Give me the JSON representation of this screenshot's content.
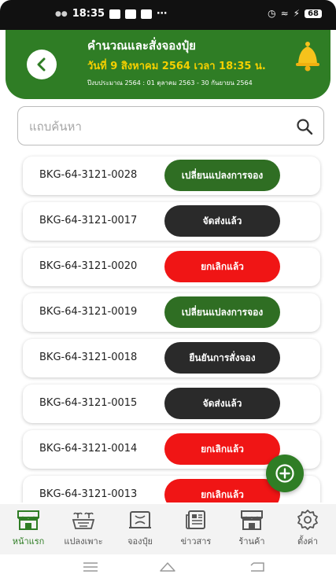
{
  "status_bar": {
    "time": "18:35",
    "battery": "68"
  },
  "header": {
    "title": "คำนวณและสั่งจองปุ๋ย",
    "date_line": "วันที่ 9 สิงหาคม 2564 เวลา 18:35 น.",
    "period_line": "ปีงบประมาณ 2564 : 01 ตุลาคม 2563 - 30 กันยายน 2564"
  },
  "search": {
    "placeholder": "แถบค้นหา"
  },
  "orders": [
    {
      "code": "BKG-64-3121-0028",
      "status": "เปลี่ยนแปลงการจอง",
      "color": "#2f6e23"
    },
    {
      "code": "BKG-64-3121-0017",
      "status": "จัดส่งแล้ว",
      "color": "#2a2a2a"
    },
    {
      "code": "BKG-64-3121-0020",
      "status": "ยกเลิกแล้ว",
      "color": "#f01515"
    },
    {
      "code": "BKG-64-3121-0019",
      "status": "เปลี่ยนแปลงการจอง",
      "color": "#2f6e23"
    },
    {
      "code": "BKG-64-3121-0018",
      "status": "ยืนยันการสั่งจอง",
      "color": "#2a2a2a"
    },
    {
      "code": "BKG-64-3121-0015",
      "status": "จัดส่งแล้ว",
      "color": "#2a2a2a"
    },
    {
      "code": "BKG-64-3121-0014",
      "status": "ยกเลิกแล้ว",
      "color": "#f01515"
    },
    {
      "code": "BKG-64-3121-0013",
      "status": "ยกเลิกแล้ว",
      "color": "#f01515"
    }
  ],
  "nav": [
    {
      "label": "หน้าแรก",
      "icon": "home-store-icon",
      "active": true
    },
    {
      "label": "แปลงเพาะ",
      "icon": "plant-plot-icon",
      "active": false
    },
    {
      "label": "จองปุ๋ย",
      "icon": "fertilizer-booking-icon",
      "active": false
    },
    {
      "label": "ข่าวสาร",
      "icon": "news-icon",
      "active": false
    },
    {
      "label": "ร้านค้า",
      "icon": "shop-icon",
      "active": false
    },
    {
      "label": "ตั้งค่า",
      "icon": "settings-gear-icon",
      "active": false
    }
  ],
  "colors": {
    "primary": "#2f7d25",
    "accent": "#f5d000",
    "cancel": "#f01515",
    "dark": "#2a2a2a"
  }
}
